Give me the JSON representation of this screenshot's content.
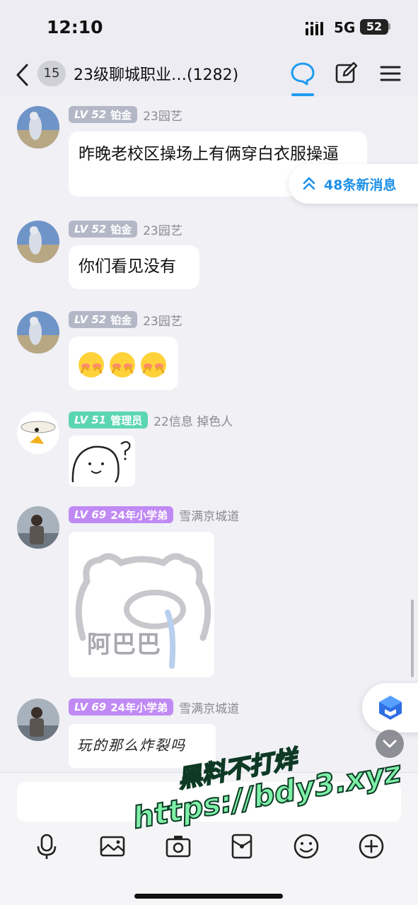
{
  "status_bar": {
    "time": "12:10",
    "network": "5G",
    "battery": "52"
  },
  "header": {
    "unread_count": "15",
    "title": "23级聊城职业…(1282)"
  },
  "new_messages_label": "48条新消息",
  "messages": [
    {
      "level": "LV 52",
      "role": "铂金",
      "nickname": "23园艺",
      "text": "昨晚老校区操场上有俩穿白衣服操逼"
    },
    {
      "level": "LV 52",
      "role": "铂金",
      "nickname": "23园艺",
      "text": "你们看见没有"
    },
    {
      "level": "LV 52",
      "role": "铂金",
      "nickname": "23园艺",
      "sticker": "three-shy-face-emojis"
    },
    {
      "level": "LV 51",
      "role": "管理员",
      "nickname": "22信息 掉色人",
      "sticker": "doodle-face-question"
    },
    {
      "level": "LV 69",
      "role": "24年小学弟",
      "nickname": "雪满京城道",
      "sticker": "bear-sticker",
      "sticker_text": "阿巴巴"
    },
    {
      "level": "LV 69",
      "role": "24年小学弟",
      "nickname": "雪满京城道",
      "sticker": "handwriting-sticker",
      "sticker_text": "玩的那么炸裂吗"
    }
  ],
  "toolbar_icons": [
    "microphone-icon",
    "image-icon",
    "camera-icon",
    "red-packet-icon",
    "emoji-icon",
    "plus-icon"
  ],
  "watermark": {
    "line1": "黑料不打烊",
    "line2": "https://bdy3.xyz"
  },
  "colors": {
    "accent": "#1e9bf0",
    "badge_gray": "#b4b7c6",
    "badge_teal": "#5bd6b2",
    "badge_purple": "#c08af5",
    "watermark": "#7ef0a8"
  }
}
